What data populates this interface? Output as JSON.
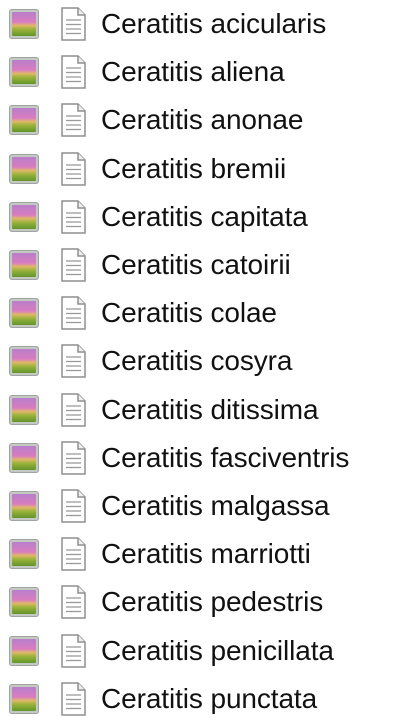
{
  "items": [
    {
      "label": "Ceratitis acicularis"
    },
    {
      "label": "Ceratitis aliena"
    },
    {
      "label": "Ceratitis anonae"
    },
    {
      "label": "Ceratitis bremii"
    },
    {
      "label": "Ceratitis capitata"
    },
    {
      "label": "Ceratitis catoirii"
    },
    {
      "label": "Ceratitis colae"
    },
    {
      "label": "Ceratitis cosyra"
    },
    {
      "label": "Ceratitis ditissima"
    },
    {
      "label": "Ceratitis fasciventris"
    },
    {
      "label": "Ceratitis malgassa"
    },
    {
      "label": "Ceratitis marriotti"
    },
    {
      "label": "Ceratitis pedestris"
    },
    {
      "label": "Ceratitis penicillata"
    },
    {
      "label": "Ceratitis punctata"
    }
  ]
}
